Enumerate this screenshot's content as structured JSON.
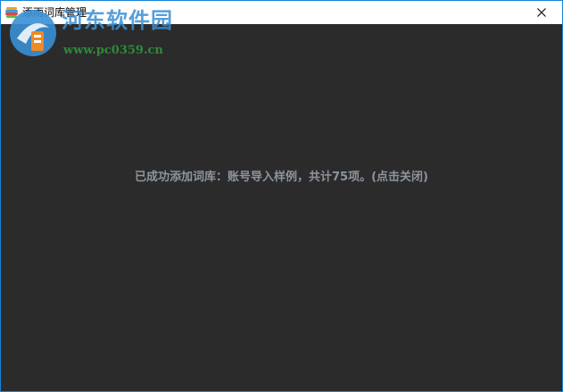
{
  "window": {
    "title": "添雨词库管理",
    "close_icon": "close-icon",
    "app_icon": "colorful-stack-icon"
  },
  "watermark": {
    "site_name": "河东软件园",
    "url": "www.pc0359.cn",
    "title_color": "#3a8fd4",
    "url_color": "#2e8b3a"
  },
  "main": {
    "message": "已成功添加词库：账号导入样例，共计75项。(点击关闭)",
    "message_color": "#8d949c",
    "background": "#2b2b2b"
  }
}
